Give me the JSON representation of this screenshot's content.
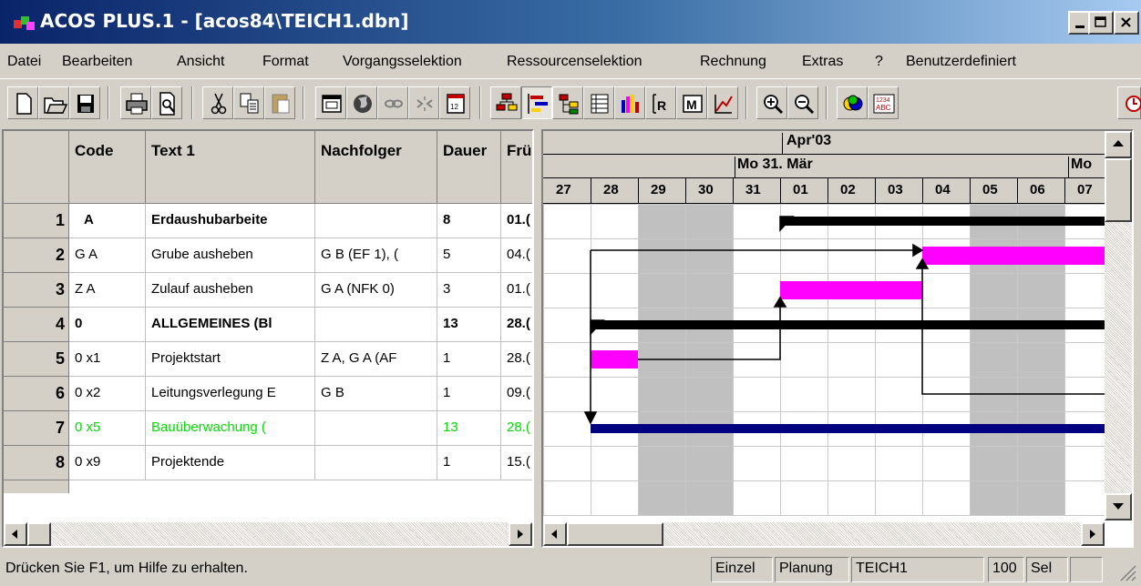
{
  "window": {
    "title": "ACOS PLUS.1 - [acos84\\TEICH1.dbn]"
  },
  "menu": [
    "Datei",
    "Bearbeiten",
    "Ansicht",
    "Format",
    "Vorgangsselektion",
    "Ressourcenselektion",
    "Rechnung",
    "Extras",
    "?",
    "Benutzerdefiniert"
  ],
  "table": {
    "columns": [
      "Code",
      "Text 1",
      "Nachfolger",
      "Dauer",
      "Frü"
    ],
    "rows": [
      {
        "num": "1",
        "code": "A",
        "text": "Erdaushubarbeite",
        "succ": "",
        "dur": "8",
        "start": "01.(",
        "style": "bold"
      },
      {
        "num": "2",
        "code": "G A",
        "text": "Grube ausheben",
        "succ": "G B (EF   1), (",
        "dur": "5",
        "start": "04.(",
        "style": "normal"
      },
      {
        "num": "3",
        "code": "Z A",
        "text": "Zulauf ausheben",
        "succ": "G A (NFK   0)",
        "dur": "3",
        "start": "01.(",
        "style": "normal"
      },
      {
        "num": "4",
        "code": "0",
        "text": "ALLGEMEINES (Bl",
        "succ": "",
        "dur": "13",
        "start": "28.(",
        "style": "bold"
      },
      {
        "num": "5",
        "code": "0 x1",
        "text": "Projektstart",
        "succ": "Z A, G A (AF",
        "dur": "1",
        "start": "28.(",
        "style": "normal"
      },
      {
        "num": "6",
        "code": "0 x2",
        "text": "Leitungsverlegung E",
        "succ": "G B",
        "dur": "1",
        "start": "09.(",
        "style": "normal"
      },
      {
        "num": "7",
        "code": "0 x5",
        "text": "Bauüberwachung (",
        "succ": "",
        "dur": "13",
        "start": "28.(",
        "style": "green"
      },
      {
        "num": "8",
        "code": "0 x9",
        "text": "Projektende",
        "succ": "",
        "dur": "1",
        "start": "15.(",
        "style": "normal"
      }
    ]
  },
  "gantt": {
    "month": "Apr'03",
    "weeks": [
      "Mo 31. Mär",
      "Mo"
    ],
    "days": [
      "27",
      "28",
      "29",
      "30",
      "31",
      "01",
      "02",
      "03",
      "04",
      "05",
      "06",
      "07"
    ],
    "weekend_days": [
      "29",
      "30",
      "05",
      "06"
    ],
    "colors": {
      "summary": "#000000",
      "task": "#ff00ff",
      "ongoing": "#000080",
      "weekend": "#c0c0c0"
    }
  },
  "status": {
    "hint": "Drücken Sie F1, um Hilfe zu erhalten.",
    "fields": [
      "Einzel",
      "Planung",
      "TEICH1",
      "",
      "100",
      "Sel",
      ""
    ]
  },
  "toolbar_icons": [
    "new-file-icon",
    "open-folder-icon",
    "save-icon",
    "print-icon",
    "print-preview-icon",
    "cut-icon",
    "copy-icon",
    "paste-icon",
    "window-icon",
    "globe-icon",
    "link-icon",
    "unlink-icon",
    "calendar-icon",
    "network-view-icon",
    "gantt-view-icon",
    "tree-view-icon",
    "table-view-icon",
    "histogram-icon",
    "resource-icon",
    "matrix-icon",
    "chart-icon",
    "zoom-in-icon",
    "zoom-out-icon",
    "circle-chart-icon",
    "number-format-icon",
    "clock-icon"
  ]
}
